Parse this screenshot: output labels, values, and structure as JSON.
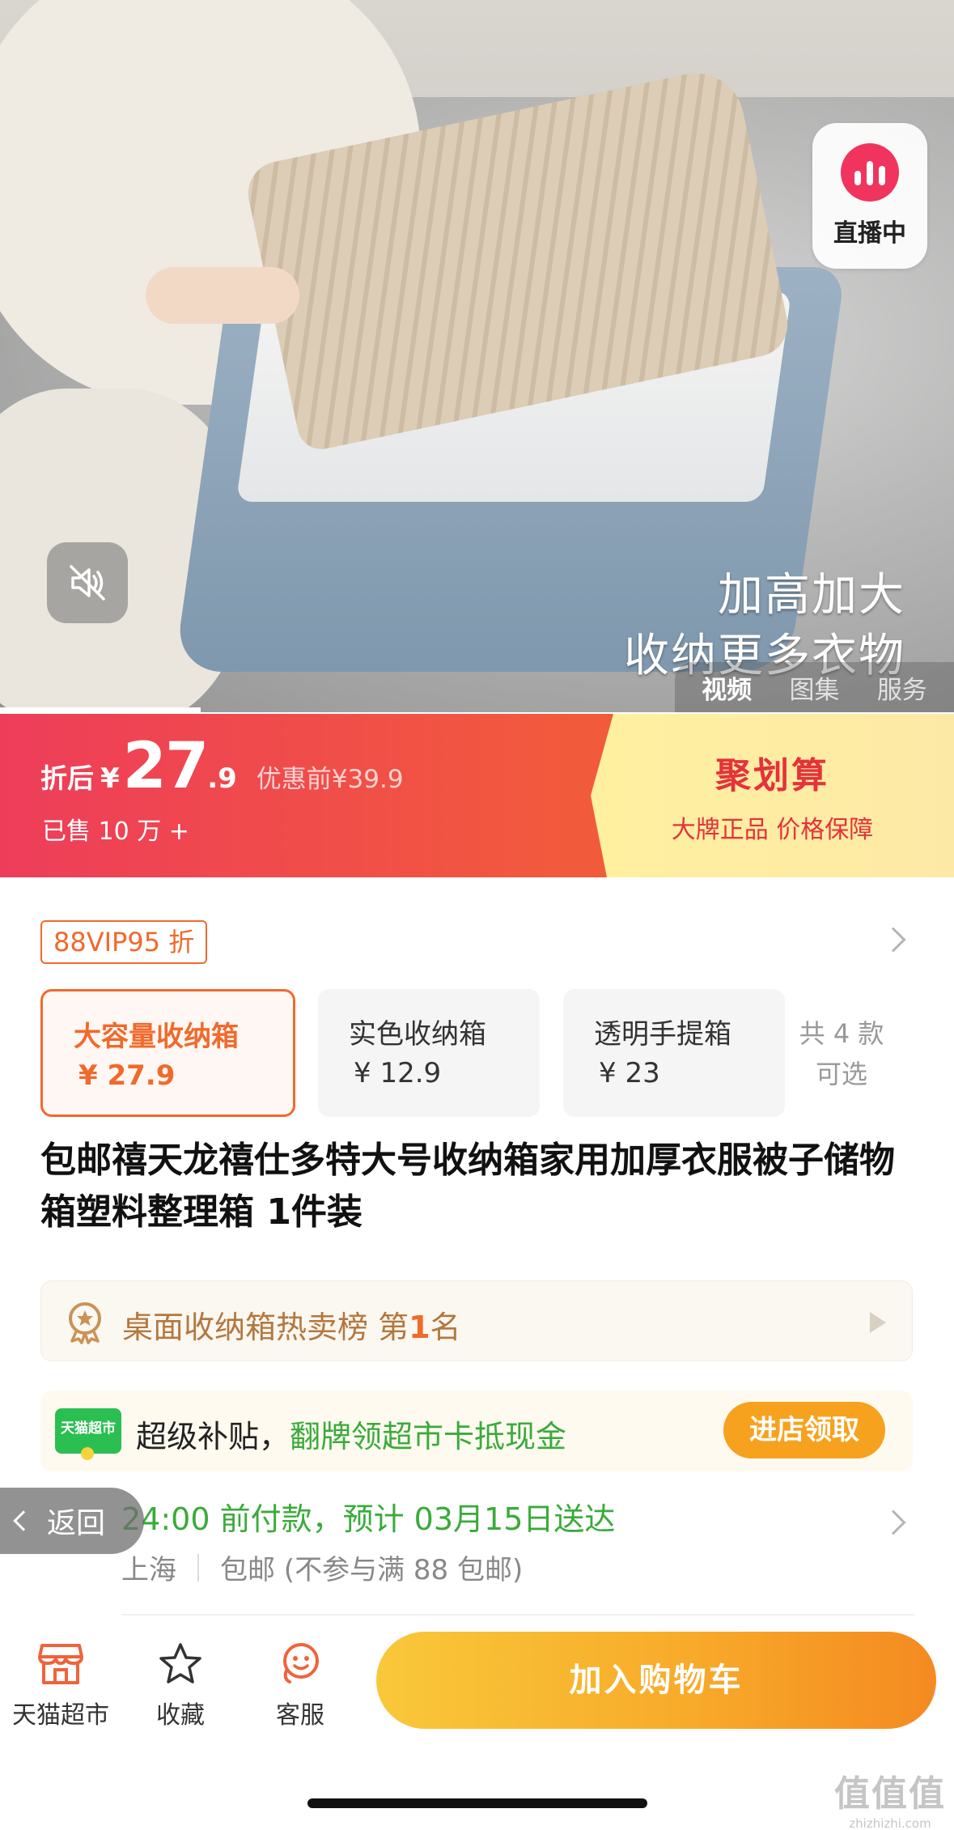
{
  "media": {
    "overlay_line1": "加高加大",
    "overlay_line2": "收纳更多衣物",
    "live_label": "直播中",
    "tabs": [
      {
        "label": "视频",
        "active": true
      },
      {
        "label": "图集",
        "active": false
      },
      {
        "label": "服务",
        "active": false
      }
    ],
    "video_progress": 0.21
  },
  "price": {
    "label": "折后",
    "currency": "¥",
    "integer": "27",
    "decimal": ".9",
    "original": "优惠前¥39.9",
    "sold": "已售 10 万 +"
  },
  "juhuasuan": {
    "title": "聚划算",
    "subtitle": "大牌正品 价格保障"
  },
  "vip_tag": "88VIP95 折",
  "variants": [
    {
      "name": "大容量收纳箱",
      "price": "¥ 27.9",
      "selected": true
    },
    {
      "name": "实色收纳箱",
      "price": "¥ 12.9",
      "selected": false
    },
    {
      "name": "透明手提箱",
      "price": "¥ 23",
      "selected": false
    }
  ],
  "more_styles": {
    "line1": "共 4 款",
    "line2": "可选"
  },
  "product_title": "包邮禧天龙禧仕多特大号收纳箱家用加厚衣服被子储物箱塑料整理箱 1件装",
  "rank": {
    "text": "桌面收纳箱热卖榜  第",
    "number": "1",
    "suffix": "名"
  },
  "subsidy": {
    "logo_text": "天猫超市",
    "text": "超级补贴，",
    "highlight": "翻牌领超市卡抵现金",
    "button": "进店领取"
  },
  "delivery": {
    "main": "24:00 前付款，预计 03月15日送达",
    "origin": "上海",
    "shipping": "包邮 (不参与满 88 包邮)"
  },
  "back_button": "返回",
  "bottom_bar": {
    "items": [
      {
        "label": "天猫超市",
        "icon": "store-icon"
      },
      {
        "label": "收藏",
        "icon": "star-icon"
      },
      {
        "label": "客服",
        "icon": "customer-service-icon"
      }
    ],
    "cart_button": "加入购物车"
  },
  "watermark": {
    "text": "值值值",
    "url": "zhizhizhi.com"
  },
  "colors": {
    "accent_orange": "#f06a2c",
    "price_red": "#ee3d5a",
    "juhuasuan_red": "#e5323b",
    "green": "#3aab3a",
    "cart_yellow": "#f9c83a"
  }
}
